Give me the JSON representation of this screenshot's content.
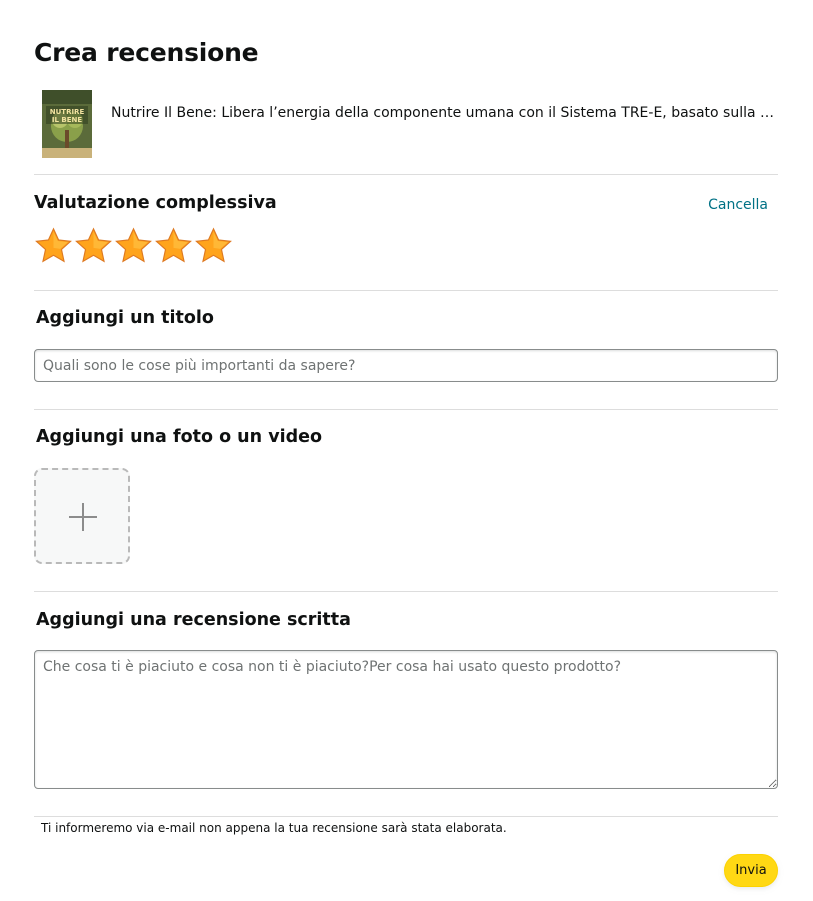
{
  "page": {
    "title": "Crea recensione"
  },
  "product": {
    "title": "Nutrire Il Bene: Libera l’energia della componente umana con il Sistema TRE-E, basato sulla Scienza del Bene",
    "cover_text": "NUTRIRE IL BENE"
  },
  "rating": {
    "heading": "Valutazione complessiva",
    "clear_label": "Cancella",
    "value": 5,
    "max": 5,
    "star_color": "#ffa41c"
  },
  "title_section": {
    "heading": "Aggiungi un titolo",
    "placeholder": "Quali sono le cose più importanti da sapere?",
    "value": ""
  },
  "media_section": {
    "heading": "Aggiungi una foto o un video",
    "add_icon": "plus-icon"
  },
  "review_section": {
    "heading": "Aggiungi una recensione scritta",
    "placeholder": "Che cosa ti è piaciuto e cosa non ti è piaciuto?Per cosa hai usato questo prodotto?",
    "value": ""
  },
  "footer": {
    "notice": "Ti informeremo via e-mail non appena la tua recensione sarà stata elaborata.",
    "submit_label": "Invia",
    "submit_color": "#ffd814"
  }
}
